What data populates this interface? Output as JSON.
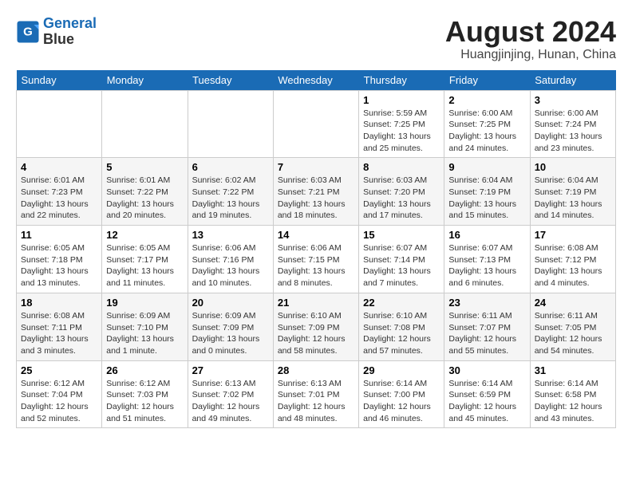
{
  "header": {
    "logo_line1": "General",
    "logo_line2": "Blue",
    "month_year": "August 2024",
    "location": "Huangjinjing, Hunan, China"
  },
  "weekdays": [
    "Sunday",
    "Monday",
    "Tuesday",
    "Wednesday",
    "Thursday",
    "Friday",
    "Saturday"
  ],
  "weeks": [
    [
      {
        "day": "",
        "info": ""
      },
      {
        "day": "",
        "info": ""
      },
      {
        "day": "",
        "info": ""
      },
      {
        "day": "",
        "info": ""
      },
      {
        "day": "1",
        "info": "Sunrise: 5:59 AM\nSunset: 7:25 PM\nDaylight: 13 hours\nand 25 minutes."
      },
      {
        "day": "2",
        "info": "Sunrise: 6:00 AM\nSunset: 7:25 PM\nDaylight: 13 hours\nand 24 minutes."
      },
      {
        "day": "3",
        "info": "Sunrise: 6:00 AM\nSunset: 7:24 PM\nDaylight: 13 hours\nand 23 minutes."
      }
    ],
    [
      {
        "day": "4",
        "info": "Sunrise: 6:01 AM\nSunset: 7:23 PM\nDaylight: 13 hours\nand 22 minutes."
      },
      {
        "day": "5",
        "info": "Sunrise: 6:01 AM\nSunset: 7:22 PM\nDaylight: 13 hours\nand 20 minutes."
      },
      {
        "day": "6",
        "info": "Sunrise: 6:02 AM\nSunset: 7:22 PM\nDaylight: 13 hours\nand 19 minutes."
      },
      {
        "day": "7",
        "info": "Sunrise: 6:03 AM\nSunset: 7:21 PM\nDaylight: 13 hours\nand 18 minutes."
      },
      {
        "day": "8",
        "info": "Sunrise: 6:03 AM\nSunset: 7:20 PM\nDaylight: 13 hours\nand 17 minutes."
      },
      {
        "day": "9",
        "info": "Sunrise: 6:04 AM\nSunset: 7:19 PM\nDaylight: 13 hours\nand 15 minutes."
      },
      {
        "day": "10",
        "info": "Sunrise: 6:04 AM\nSunset: 7:19 PM\nDaylight: 13 hours\nand 14 minutes."
      }
    ],
    [
      {
        "day": "11",
        "info": "Sunrise: 6:05 AM\nSunset: 7:18 PM\nDaylight: 13 hours\nand 13 minutes."
      },
      {
        "day": "12",
        "info": "Sunrise: 6:05 AM\nSunset: 7:17 PM\nDaylight: 13 hours\nand 11 minutes."
      },
      {
        "day": "13",
        "info": "Sunrise: 6:06 AM\nSunset: 7:16 PM\nDaylight: 13 hours\nand 10 minutes."
      },
      {
        "day": "14",
        "info": "Sunrise: 6:06 AM\nSunset: 7:15 PM\nDaylight: 13 hours\nand 8 minutes."
      },
      {
        "day": "15",
        "info": "Sunrise: 6:07 AM\nSunset: 7:14 PM\nDaylight: 13 hours\nand 7 minutes."
      },
      {
        "day": "16",
        "info": "Sunrise: 6:07 AM\nSunset: 7:13 PM\nDaylight: 13 hours\nand 6 minutes."
      },
      {
        "day": "17",
        "info": "Sunrise: 6:08 AM\nSunset: 7:12 PM\nDaylight: 13 hours\nand 4 minutes."
      }
    ],
    [
      {
        "day": "18",
        "info": "Sunrise: 6:08 AM\nSunset: 7:11 PM\nDaylight: 13 hours\nand 3 minutes."
      },
      {
        "day": "19",
        "info": "Sunrise: 6:09 AM\nSunset: 7:10 PM\nDaylight: 13 hours\nand 1 minute."
      },
      {
        "day": "20",
        "info": "Sunrise: 6:09 AM\nSunset: 7:09 PM\nDaylight: 13 hours\nand 0 minutes."
      },
      {
        "day": "21",
        "info": "Sunrise: 6:10 AM\nSunset: 7:09 PM\nDaylight: 12 hours\nand 58 minutes."
      },
      {
        "day": "22",
        "info": "Sunrise: 6:10 AM\nSunset: 7:08 PM\nDaylight: 12 hours\nand 57 minutes."
      },
      {
        "day": "23",
        "info": "Sunrise: 6:11 AM\nSunset: 7:07 PM\nDaylight: 12 hours\nand 55 minutes."
      },
      {
        "day": "24",
        "info": "Sunrise: 6:11 AM\nSunset: 7:05 PM\nDaylight: 12 hours\nand 54 minutes."
      }
    ],
    [
      {
        "day": "25",
        "info": "Sunrise: 6:12 AM\nSunset: 7:04 PM\nDaylight: 12 hours\nand 52 minutes."
      },
      {
        "day": "26",
        "info": "Sunrise: 6:12 AM\nSunset: 7:03 PM\nDaylight: 12 hours\nand 51 minutes."
      },
      {
        "day": "27",
        "info": "Sunrise: 6:13 AM\nSunset: 7:02 PM\nDaylight: 12 hours\nand 49 minutes."
      },
      {
        "day": "28",
        "info": "Sunrise: 6:13 AM\nSunset: 7:01 PM\nDaylight: 12 hours\nand 48 minutes."
      },
      {
        "day": "29",
        "info": "Sunrise: 6:14 AM\nSunset: 7:00 PM\nDaylight: 12 hours\nand 46 minutes."
      },
      {
        "day": "30",
        "info": "Sunrise: 6:14 AM\nSunset: 6:59 PM\nDaylight: 12 hours\nand 45 minutes."
      },
      {
        "day": "31",
        "info": "Sunrise: 6:14 AM\nSunset: 6:58 PM\nDaylight: 12 hours\nand 43 minutes."
      }
    ]
  ]
}
